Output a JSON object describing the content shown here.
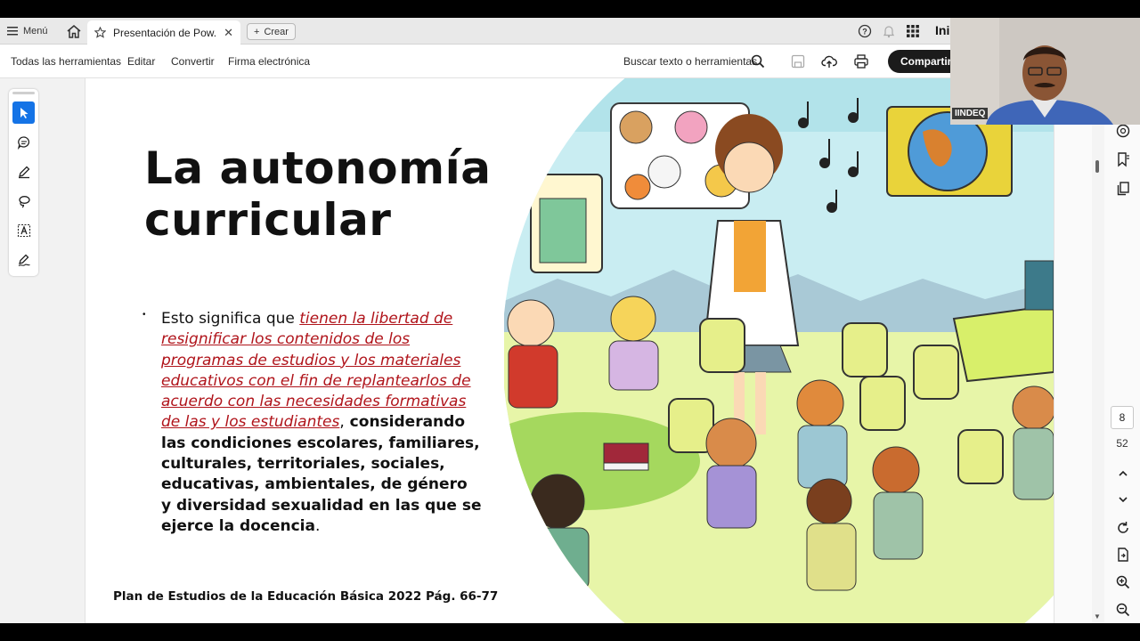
{
  "tabbar": {
    "menu_label": "Menú",
    "tab_title": "Presentación de Pow...",
    "tab_close": "✕",
    "new_label": "Crear",
    "signin_label": "Ini"
  },
  "toolbar": {
    "items": [
      "Todas las herramientas",
      "Editar",
      "Convertir",
      "Firma electrónica"
    ],
    "search_label": "Buscar texto o herramientas",
    "share_label": "Compartir"
  },
  "slide": {
    "title_line1": "La autonomía",
    "title_line2": "curricular",
    "bullet": "•",
    "lead": "Esto significa que ",
    "link": "tienen la libertad de resignificar los contenidos de los programas de estudios y los materiales educativos con el fin de replantearlos de acuerdo con las necesidades formativas de las y los estudiantes",
    "comma": ",",
    "rest": " considerando las condiciones escolares, familiares, culturales, territoriales, sociales, educativas, ambientales, de género y diversidad sexualidad en las que se ejerce la docencia",
    "period": ".",
    "footer": "Plan de Estudios de la Educación Básica 2022  Pág. 66-77"
  },
  "pager": {
    "current_page": "8",
    "total_pages": "52"
  },
  "webcam": {
    "label": "IINDEQ"
  },
  "colors": {
    "accent": "#1473e6",
    "link": "#b0141b",
    "share_bg": "#1b1b1b"
  },
  "icons": {
    "tabbar": [
      "hamburger-icon",
      "home-icon",
      "star-icon",
      "plus-icon",
      "help-icon",
      "bell-icon",
      "apps-grid-icon"
    ],
    "toolbar": [
      "search-icon",
      "save-icon",
      "upload-cloud-icon",
      "print-icon"
    ],
    "left_tools": [
      "select-cursor-icon",
      "comment-icon",
      "pen-icon",
      "lasso-icon",
      "text-select-icon",
      "sign-icon"
    ],
    "right_tools": [
      "ai-assistant-icon",
      "bookmark-icon",
      "pages-icon",
      "chevron-up-icon",
      "chevron-down-icon",
      "refresh-icon",
      "file-export-icon",
      "zoom-in-icon",
      "zoom-out-icon"
    ]
  }
}
